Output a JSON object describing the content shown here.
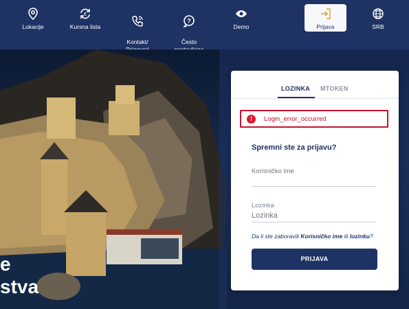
{
  "nav": {
    "items": [
      {
        "label": "Lokacije",
        "icon": "location-icon"
      },
      {
        "label": "Kursna lista",
        "icon": "exchange-icon"
      },
      {
        "label": "Kontakt/\nPrigovori",
        "icon": "phone-icon"
      },
      {
        "label": "Često\npostavljana\npitanja",
        "icon": "faq-icon"
      },
      {
        "label": "Demo",
        "icon": "eye-icon"
      },
      {
        "label": "Prijava",
        "icon": "login-icon"
      },
      {
        "label": "SRB",
        "icon": "globe-icon"
      }
    ]
  },
  "hero": {
    "text_line1": "e",
    "text_line2": "stva"
  },
  "login": {
    "tab_active": "LOZINKA",
    "tab_inactive": "MTOKEN",
    "error": "Login_error_occurred",
    "heading": "Spremni ste za prijavu?",
    "username_placeholder": "Korisničko ime",
    "password_label": "Lozinka",
    "password_placeholder": "Lozinka",
    "forgot_prefix": "Da li ste zaboravili",
    "forgot_username": "Korisničko ime",
    "forgot_or": "ili",
    "forgot_password": "lozinku",
    "forgot_suffix": "?",
    "submit": "PRIJAVA"
  },
  "colors": {
    "brand": "#1e3264",
    "error": "#c8102e"
  }
}
